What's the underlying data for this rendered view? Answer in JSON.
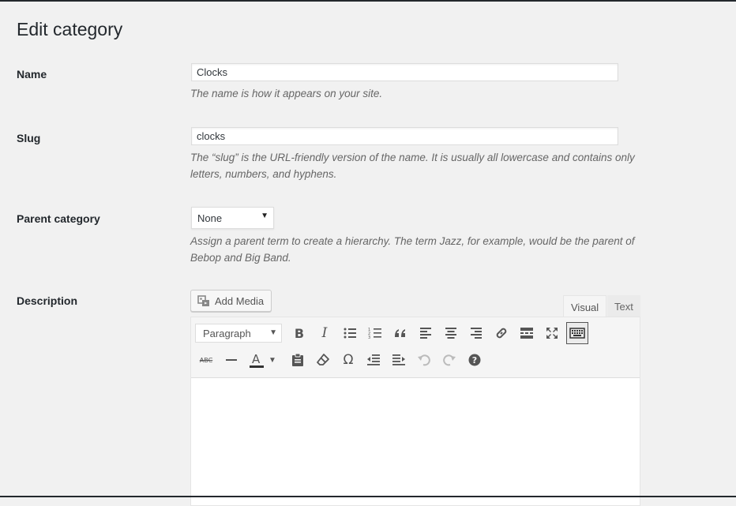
{
  "page": {
    "title": "Edit category"
  },
  "fields": {
    "name": {
      "label": "Name",
      "value": "Clocks",
      "help": "The name is how it appears on your site."
    },
    "slug": {
      "label": "Slug",
      "value": "clocks",
      "help": "The “slug” is the URL-friendly version of the name. It is usually all lowercase and contains only letters, numbers, and hyphens."
    },
    "parent": {
      "label": "Parent category",
      "selected": "None",
      "help": "Assign a parent term to create a hierarchy. The term Jazz, for example, would be the parent of Bebop and Big Band."
    },
    "description": {
      "label": "Description"
    }
  },
  "editor": {
    "add_media_label": "Add Media",
    "tabs": {
      "visual": "Visual",
      "text": "Text"
    },
    "format_select": "Paragraph",
    "row1_icons": [
      "bold-icon",
      "italic-icon",
      "bulleted-list-icon",
      "numbered-list-icon",
      "blockquote-icon",
      "align-left-icon",
      "align-center-icon",
      "align-right-icon",
      "link-icon",
      "read-more-icon",
      "fullscreen-icon",
      "toolbar-toggle-icon"
    ],
    "row2_icons": [
      "strikethrough-icon",
      "horizontal-line-icon",
      "text-color-icon",
      "paste-as-text-icon",
      "clear-formatting-icon",
      "special-character-icon",
      "outdent-icon",
      "indent-icon",
      "undo-icon",
      "redo-icon",
      "help-icon"
    ],
    "labels": {
      "bold": "B",
      "italic": "I",
      "strike": "ABC",
      "text_color": "A",
      "omega": "Ω"
    }
  }
}
